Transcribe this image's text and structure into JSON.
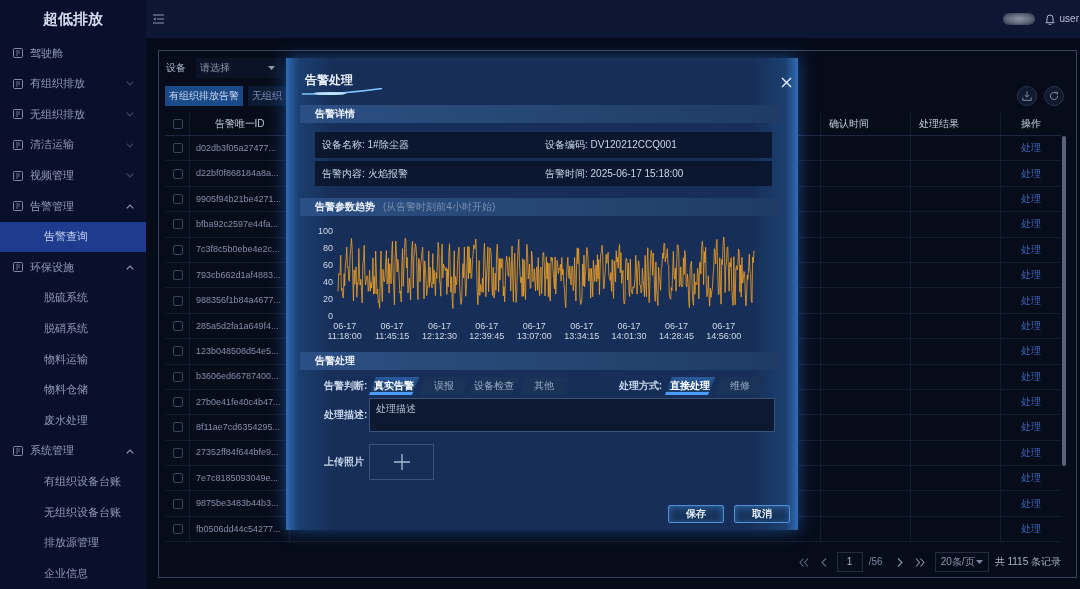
{
  "sidebar": {
    "title": "超低排放",
    "items": [
      {
        "label": "驾驶舱",
        "kind": "link"
      },
      {
        "label": "有组织排放",
        "kind": "group",
        "expanded": false
      },
      {
        "label": "无组织排放",
        "kind": "group",
        "expanded": false
      },
      {
        "label": "清洁运输",
        "kind": "group",
        "expanded": false
      },
      {
        "label": "视频管理",
        "kind": "group",
        "expanded": false
      },
      {
        "label": "告警管理",
        "kind": "group",
        "expanded": true,
        "children": [
          {
            "label": "告警查询",
            "selected": true
          }
        ]
      },
      {
        "label": "环保设施",
        "kind": "group",
        "expanded": true,
        "children": [
          {
            "label": "脱硫系统",
            "selected": false
          },
          {
            "label": "脱硝系统",
            "selected": false
          },
          {
            "label": "物料运输",
            "selected": false
          },
          {
            "label": "物料仓储",
            "selected": false
          },
          {
            "label": "废水处理",
            "selected": false
          }
        ]
      },
      {
        "label": "系统管理",
        "kind": "group",
        "expanded": true,
        "children": [
          {
            "label": "有组织设备台账",
            "selected": false
          },
          {
            "label": "无组织设备台账",
            "selected": false
          },
          {
            "label": "排放源管理",
            "selected": false
          },
          {
            "label": "企业信息",
            "selected": false
          }
        ]
      }
    ]
  },
  "topbar": {
    "user": "user"
  },
  "filters": [
    {
      "label": "设备",
      "placeholder": "请选择"
    }
  ],
  "tabs": [
    {
      "label": "有组织排放告警",
      "selected": true
    },
    {
      "label": "无组织",
      "selected": false
    }
  ],
  "table": {
    "columns": [
      "告警唯一ID",
      "确认时间",
      "处理结果",
      "操作"
    ],
    "select_all_checked": false,
    "rows": [
      {
        "id": "d02db3f05a27477...",
        "checked": false,
        "action": "处理"
      },
      {
        "id": "d22bf0f868184a8a...",
        "checked": false,
        "action": "处理"
      },
      {
        "id": "9905f94b21be4271...",
        "checked": false,
        "action": "处理"
      },
      {
        "id": "bfba92c2597e44fa...",
        "checked": false,
        "action": "处理"
      },
      {
        "id": "7c3f8c5b0ebe4e2c...",
        "checked": false,
        "action": "处理"
      },
      {
        "id": "793cb662d1af4883...",
        "checked": false,
        "action": "处理"
      },
      {
        "id": "988356f1b84a4677...",
        "checked": false,
        "action": "处理"
      },
      {
        "id": "285a5d2fa1a649f4...",
        "checked": false,
        "action": "处理"
      },
      {
        "id": "123b048508d54e5...",
        "checked": false,
        "action": "处理"
      },
      {
        "id": "b3606ed66787400...",
        "checked": false,
        "action": "处理"
      },
      {
        "id": "27b0e41fe40c4b47...",
        "checked": false,
        "action": "处理"
      },
      {
        "id": "8f11ae7cd6354295...",
        "checked": false,
        "action": "处理"
      },
      {
        "id": "27352ff84f644bfe9...",
        "checked": false,
        "action": "处理"
      },
      {
        "id": "7e7c8185093049e...",
        "checked": false,
        "action": "处理"
      },
      {
        "id": "9875be3483b44b3...",
        "checked": false,
        "action": "处理"
      },
      {
        "id": "fb0506dd44c54277...",
        "checked": false,
        "action": "处理"
      }
    ]
  },
  "pagination": {
    "current_page": "1",
    "page_count": "/56",
    "page_size": "20条/页",
    "total": "共 1115 条记录"
  },
  "modal": {
    "title": "告警处理",
    "details": {
      "heading": "告警详情",
      "rows": [
        [
          "设备名称: 1#除尘器",
          "设备编码: DV120212CCQ001"
        ],
        [
          "告警内容: 火焰报警",
          "告警时间: 2025-06-17 15:18:00"
        ]
      ]
    },
    "trend": {
      "heading": "告警参数趋势",
      "note": "(从告警时刻前4小时开始)",
      "y_ticks": [
        "100",
        "80",
        "60",
        "40",
        "20",
        "0"
      ],
      "x_ticks": [
        {
          "date": "06-17",
          "time": "11:18:00"
        },
        {
          "date": "06-17",
          "time": "11:45:15"
        },
        {
          "date": "06-17",
          "time": "12:12:30"
        },
        {
          "date": "06-17",
          "time": "12:39:45"
        },
        {
          "date": "06-17",
          "time": "13:07:00"
        },
        {
          "date": "06-17",
          "time": "13:34:15"
        },
        {
          "date": "06-17",
          "time": "14:01:30"
        },
        {
          "date": "06-17",
          "time": "14:28:45"
        },
        {
          "date": "06-17",
          "time": "14:56:00"
        }
      ]
    },
    "handling": {
      "heading": "告警处理",
      "judgement": {
        "label": "告警判断:",
        "options": [
          {
            "label": "真实告警",
            "selected": true
          },
          {
            "label": "误报",
            "selected": false
          },
          {
            "label": "设备检查",
            "selected": false
          },
          {
            "label": "其他",
            "selected": false
          }
        ]
      },
      "method": {
        "label": "处理方式:",
        "options": [
          {
            "label": "直接处理",
            "selected": true
          },
          {
            "label": "维修",
            "selected": false
          }
        ]
      },
      "description": {
        "label": "处理描述:",
        "placeholder": "处理描述"
      },
      "upload": {
        "label": "上传照片"
      }
    },
    "buttons": [
      "保存",
      "取消"
    ]
  }
}
